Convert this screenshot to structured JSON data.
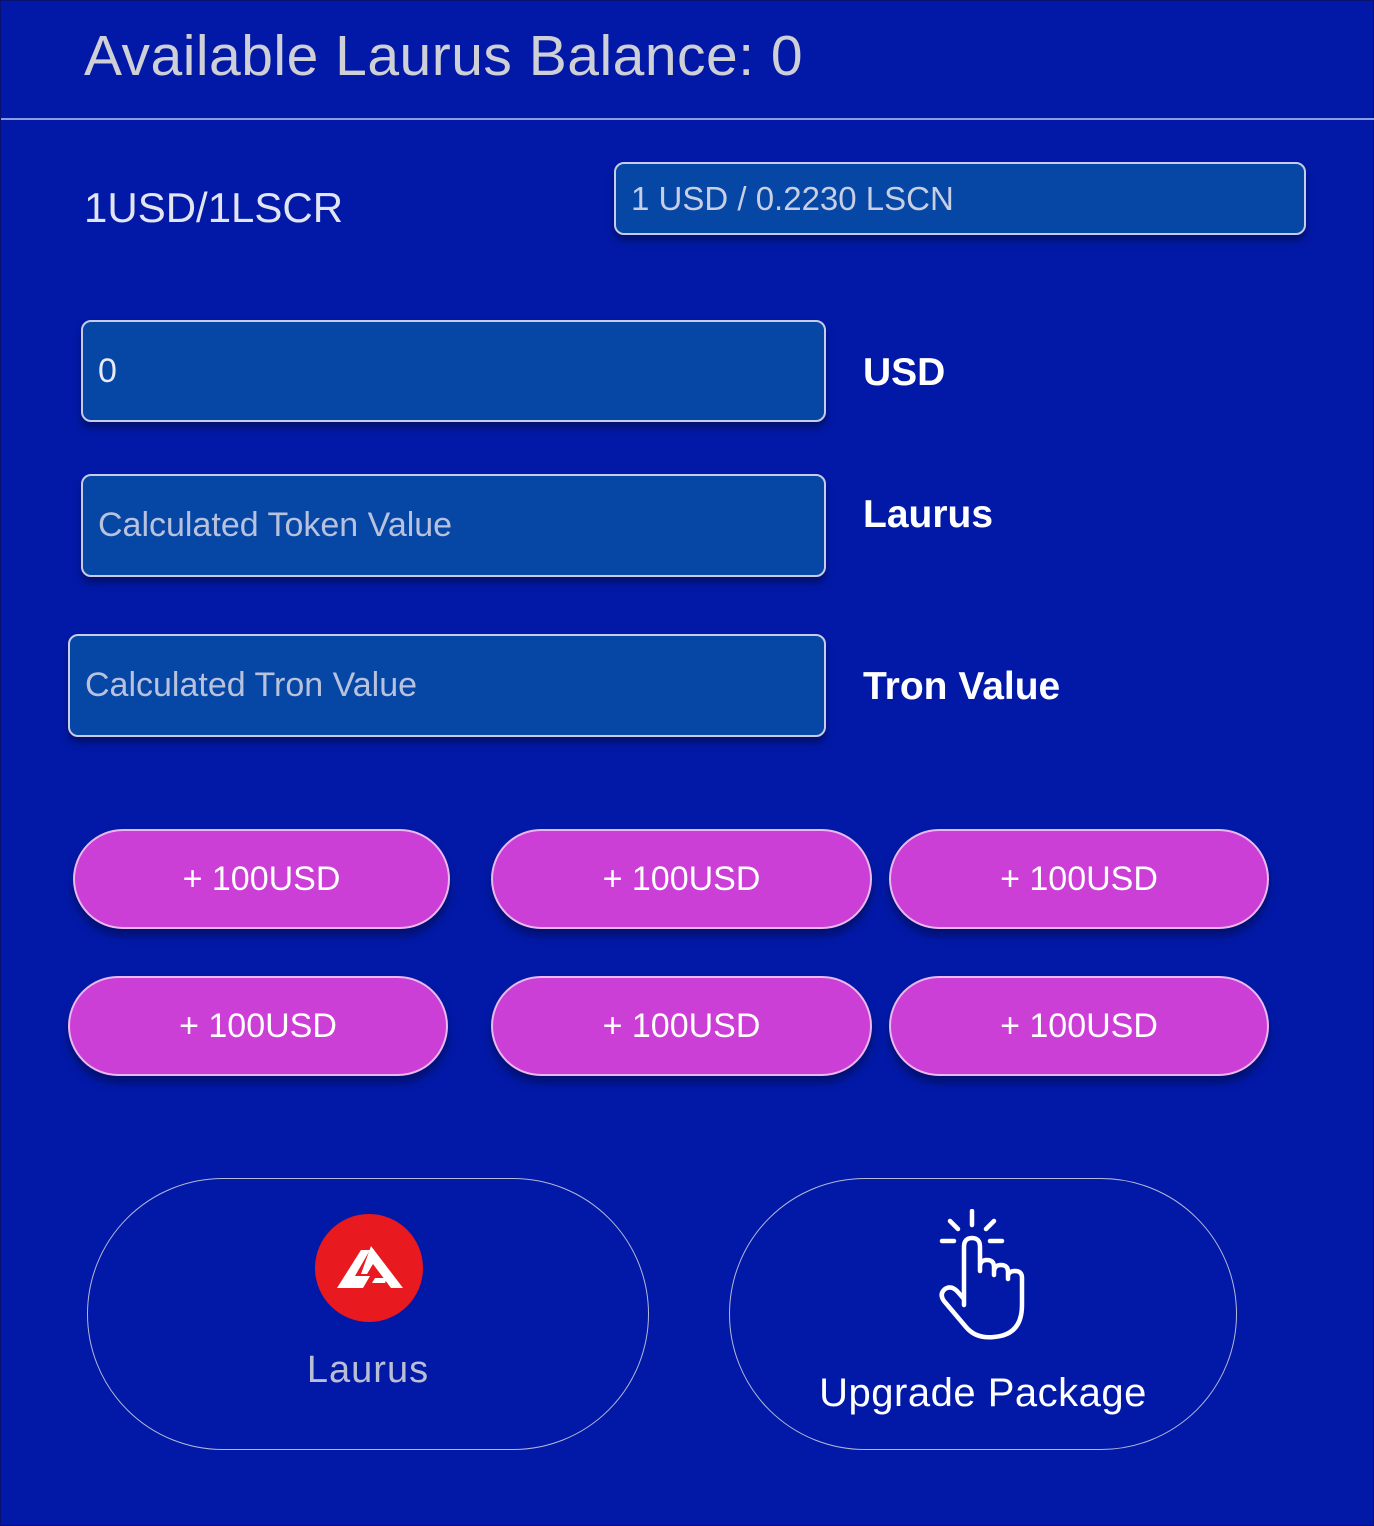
{
  "header": {
    "balance_title": "Available Laurus Balance: 0"
  },
  "rate": {
    "label": "1USD/1LSCR",
    "field_value": "1 USD / 0.2230 LSCN"
  },
  "converter": {
    "usd_value": "0",
    "usd_label": "USD",
    "token_placeholder": "Calculated Token Value",
    "token_label": "Laurus",
    "tron_placeholder": "Calculated Tron Value",
    "tron_label": "Tron Value"
  },
  "quick_add": [
    {
      "label": "+ 100USD"
    },
    {
      "label": "+ 100USD"
    },
    {
      "label": "+ 100USD"
    },
    {
      "label": "+ 100USD"
    },
    {
      "label": "+ 100USD"
    },
    {
      "label": "+ 100USD"
    }
  ],
  "actions": {
    "laurus": {
      "label": "Laurus",
      "icon": "laurus-logo-icon"
    },
    "upgrade": {
      "label": "Upgrade Package",
      "icon": "pointing-hand-click-icon"
    }
  },
  "colors": {
    "background": "#0219a8",
    "field_fill": "#0646a5",
    "pill_fill": "#cc3fd6",
    "logo_red": "#e8191f"
  }
}
